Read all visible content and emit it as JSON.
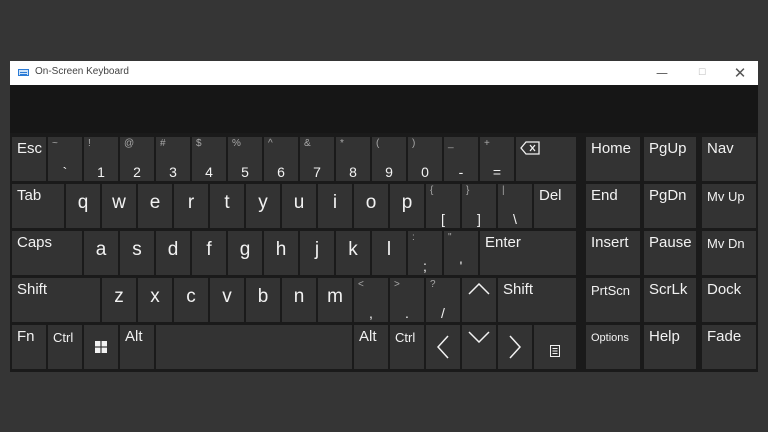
{
  "window": {
    "title": "On-Screen Keyboard",
    "minimize": "—",
    "maximize": "☐",
    "close": "✕"
  },
  "row1": {
    "esc": "Esc",
    "digits": [
      {
        "shift": "~",
        "main": "`"
      },
      {
        "shift": "!",
        "main": "1"
      },
      {
        "shift": "@",
        "main": "2"
      },
      {
        "shift": "#",
        "main": "3"
      },
      {
        "shift": "$",
        "main": "4"
      },
      {
        "shift": "%",
        "main": "5"
      },
      {
        "shift": "^",
        "main": "6"
      },
      {
        "shift": "&",
        "main": "7"
      },
      {
        "shift": "*",
        "main": "8"
      },
      {
        "shift": "(",
        "main": "9"
      },
      {
        "shift": ")",
        "main": "0"
      },
      {
        "shift": "_",
        "main": "-"
      },
      {
        "shift": "+",
        "main": "="
      }
    ]
  },
  "row2": {
    "tab": "Tab",
    "letters": [
      "q",
      "w",
      "e",
      "r",
      "t",
      "y",
      "u",
      "i",
      "o",
      "p"
    ],
    "symbols": [
      {
        "shift": "{",
        "main": "["
      },
      {
        "shift": "}",
        "main": "]"
      },
      {
        "shift": "|",
        "main": "\\"
      }
    ],
    "del": "Del"
  },
  "row3": {
    "caps": "Caps",
    "letters": [
      "a",
      "s",
      "d",
      "f",
      "g",
      "h",
      "j",
      "k",
      "l"
    ],
    "symbols": [
      {
        "shift": ":",
        "main": ";"
      },
      {
        "shift": "\"",
        "main": "'"
      }
    ],
    "enter": "Enter"
  },
  "row4": {
    "shift_left": "Shift",
    "letters": [
      "z",
      "x",
      "c",
      "v",
      "b",
      "n",
      "m"
    ],
    "symbols": [
      {
        "shift": "<",
        "main": ","
      },
      {
        "shift": ">",
        "main": "."
      },
      {
        "shift": "?",
        "main": "/"
      }
    ],
    "shift_right": "Shift"
  },
  "row5": {
    "fn": "Fn",
    "ctrl_left": "Ctrl",
    "alt_left": "Alt",
    "alt_right": "Alt",
    "ctrl_right": "Ctrl"
  },
  "nav": {
    "home": "Home",
    "pgup": "PgUp",
    "navkey": "Nav",
    "end": "End",
    "pgdn": "PgDn",
    "mvup": "Mv Up",
    "insert": "Insert",
    "pause": "Pause",
    "mvdn": "Mv Dn",
    "prtscn": "PrtScn",
    "scrlk": "ScrLk",
    "dock": "Dock",
    "options": "Options",
    "help": "Help",
    "fade": "Fade"
  }
}
